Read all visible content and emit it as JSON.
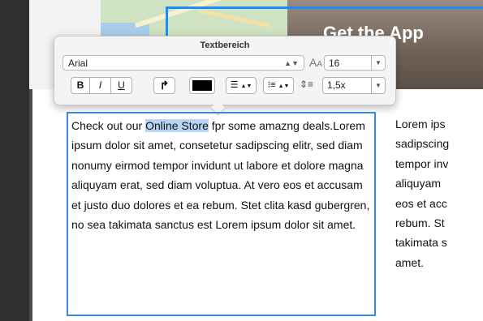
{
  "banner": {
    "app_title": "Get the App"
  },
  "popover": {
    "title": "Textbereich",
    "font_family": "Arial",
    "font_size": "16",
    "line_spacing": "1,5x",
    "bold_label": "B",
    "italic_label": "I",
    "underline_label": "U",
    "text_color": "#000000",
    "icons": {
      "font_select_chevron": "updown-chevron-icon",
      "font_size": "font-size-icon",
      "redo": "redo-arrow-icon",
      "align": "align-left-icon",
      "list": "list-bullets-icon",
      "line_spacing": "line-spacing-icon"
    }
  },
  "editor": {
    "text_before": "Check out our ",
    "highlighted": "Online Store",
    "text_after": " fpr some amazng deals.Lorem ipsum dolor sit amet, consetetur sadipscing elitr, sed diam nonumy eirmod tempor invidunt ut labore et dolore magna aliquyam erat, sed diam voluptua. At vero eos et accusam et justo duo dolores et ea rebum. Stet clita kasd gubergren, no sea takimata sanctus est Lorem ipsum dolor sit amet."
  },
  "right_column": {
    "lines": [
      "Lorem ips",
      "sadipscing",
      "tempor inv",
      "aliquyam",
      "eos et acc",
      "rebum. St",
      "takimata s",
      "amet."
    ]
  },
  "colors": {
    "annotation": "#1a8cff",
    "selection_highlight": "#b6d4f4",
    "editor_border": "#3b8ad9"
  }
}
